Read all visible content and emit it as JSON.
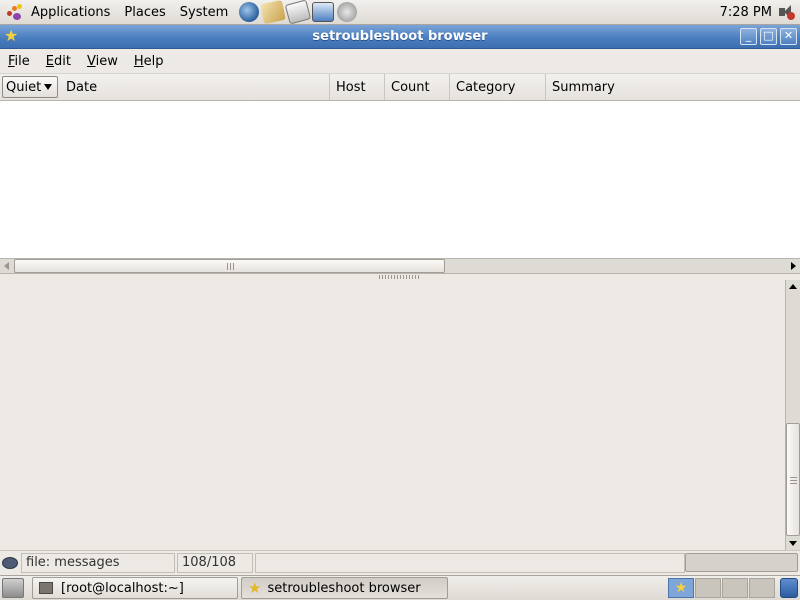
{
  "top_panel": {
    "menus": [
      "Applications",
      "Places",
      "System"
    ],
    "launchers": [
      "web-browser-icon",
      "email-icon",
      "text-editor-icon",
      "presentation-icon",
      "help-icon"
    ],
    "clock": "7:28 PM"
  },
  "window": {
    "title": "setroubleshoot browser",
    "controls": [
      "minimize-icon",
      "maximize-icon",
      "close-icon"
    ]
  },
  "menubar": {
    "items": [
      {
        "label": "File",
        "mnemonic": "F"
      },
      {
        "label": "Edit",
        "mnemonic": "E"
      },
      {
        "label": "View",
        "mnemonic": "V"
      },
      {
        "label": "Help",
        "mnemonic": "H"
      }
    ]
  },
  "columns": {
    "filter": "Quiet",
    "headers": [
      "Date",
      "Host",
      "Count",
      "Category",
      "Summary"
    ]
  },
  "alerts": [],
  "statusbar": {
    "file": "file: messages",
    "count": "108/108",
    "message": ""
  },
  "bottom_panel": {
    "tasks": [
      {
        "label": "[root@localhost:~]",
        "icon": "terminal-icon",
        "active": false
      },
      {
        "label": "setroubleshoot browser",
        "icon": "star-icon",
        "active": true
      }
    ],
    "workspaces": 4,
    "active_workspace": 1
  },
  "colors": {
    "titlebar": "#4a7ec0",
    "panel": "#edeae6",
    "list_bg": "#ffffff"
  }
}
